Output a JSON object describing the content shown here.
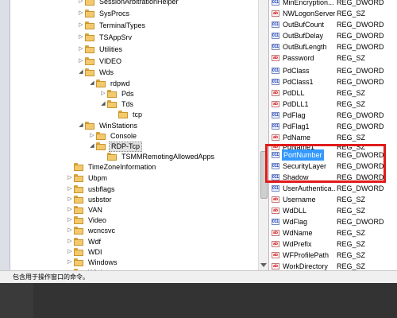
{
  "tree": {
    "items": [
      {
        "label": "SessionArbitrationHelper",
        "expander": "▷"
      },
      {
        "label": "SysProcs",
        "expander": "▷"
      },
      {
        "label": "TerminalTypes",
        "expander": "▷"
      },
      {
        "label": "TSAppSrv",
        "expander": "▷"
      },
      {
        "label": "Utilities",
        "expander": "▷"
      },
      {
        "label": "VIDEO",
        "expander": "▷"
      },
      {
        "label": "Wds",
        "expander": "◢"
      },
      {
        "label": "rdpwd",
        "expander": "◢"
      },
      {
        "label": "Pds",
        "expander": "▷"
      },
      {
        "label": "Tds",
        "expander": "◢"
      },
      {
        "label": "tcp",
        "expander": ""
      },
      {
        "label": "WinStations",
        "expander": "◢"
      },
      {
        "label": "Console",
        "expander": "▷"
      },
      {
        "label": "RDP-Tcp",
        "expander": "◢"
      },
      {
        "label": "TSMMRemotingAllowedApps",
        "expander": ""
      },
      {
        "label": "TimeZoneInformation",
        "expander": ""
      },
      {
        "label": "Ubpm",
        "expander": "▷"
      },
      {
        "label": "usbflags",
        "expander": "▷"
      },
      {
        "label": "usbstor",
        "expander": "▷"
      },
      {
        "label": "VAN",
        "expander": "▷"
      },
      {
        "label": "Video",
        "expander": "▷"
      },
      {
        "label": "wcncsvc",
        "expander": "▷"
      },
      {
        "label": "Wdf",
        "expander": "▷"
      },
      {
        "label": "WDI",
        "expander": "▷"
      },
      {
        "label": "Windows",
        "expander": "▷"
      },
      {
        "label": "Winlogon",
        "expander": "▷"
      }
    ]
  },
  "values": {
    "rows": [
      {
        "name": "MinEncryption...",
        "type": "REG_DWORD",
        "icon": "dword"
      },
      {
        "name": "NWLogonServer",
        "type": "REG_SZ",
        "icon": "string"
      },
      {
        "name": "OutBufCount",
        "type": "REG_DWORD",
        "icon": "dword"
      },
      {
        "name": "OutBufDelay",
        "type": "REG_DWORD",
        "icon": "dword"
      },
      {
        "name": "OutBufLength",
        "type": "REG_DWORD",
        "icon": "dword"
      },
      {
        "name": "Password",
        "type": "REG_SZ",
        "icon": "string"
      },
      {
        "name": "PdClass",
        "type": "REG_DWORD",
        "icon": "dword"
      },
      {
        "name": "PdClass1",
        "type": "REG_DWORD",
        "icon": "dword"
      },
      {
        "name": "PdDLL",
        "type": "REG_SZ",
        "icon": "string"
      },
      {
        "name": "PdDLL1",
        "type": "REG_SZ",
        "icon": "string"
      },
      {
        "name": "PdFlag",
        "type": "REG_DWORD",
        "icon": "dword"
      },
      {
        "name": "PdFlag1",
        "type": "REG_DWORD",
        "icon": "dword"
      },
      {
        "name": "PdName",
        "type": "REG_SZ",
        "icon": "string"
      },
      {
        "name": "PdName1",
        "type": "REG_SZ",
        "icon": "string"
      },
      {
        "name": "PortNumber",
        "type": "REG_DWORD",
        "icon": "dword",
        "selected": true
      },
      {
        "name": "SecurityLayer",
        "type": "REG_DWORD",
        "icon": "dword"
      },
      {
        "name": "Shadow",
        "type": "REG_DWORD",
        "icon": "dword"
      },
      {
        "name": "UserAuthentica...",
        "type": "REG_DWORD",
        "icon": "dword"
      },
      {
        "name": "Username",
        "type": "REG_SZ",
        "icon": "string"
      },
      {
        "name": "WdDLL",
        "type": "REG_SZ",
        "icon": "string"
      },
      {
        "name": "WdFlag",
        "type": "REG_DWORD",
        "icon": "dword"
      },
      {
        "name": "WdName",
        "type": "REG_SZ",
        "icon": "string"
      },
      {
        "name": "WdPrefix",
        "type": "REG_SZ",
        "icon": "string"
      },
      {
        "name": "WFProfilePath",
        "type": "REG_SZ",
        "icon": "string"
      },
      {
        "name": "WorkDirectory",
        "type": "REG_SZ",
        "icon": "string"
      }
    ]
  },
  "statusbar": {
    "text": "包含用于操作窗口的命令。"
  },
  "colors": {
    "highlight_box": "#e01b1b",
    "selection": "#3399ff",
    "folder": "#f3c96b"
  },
  "icons": {
    "dword_icon_glyph": "011",
    "string_icon_glyph": "ab"
  }
}
